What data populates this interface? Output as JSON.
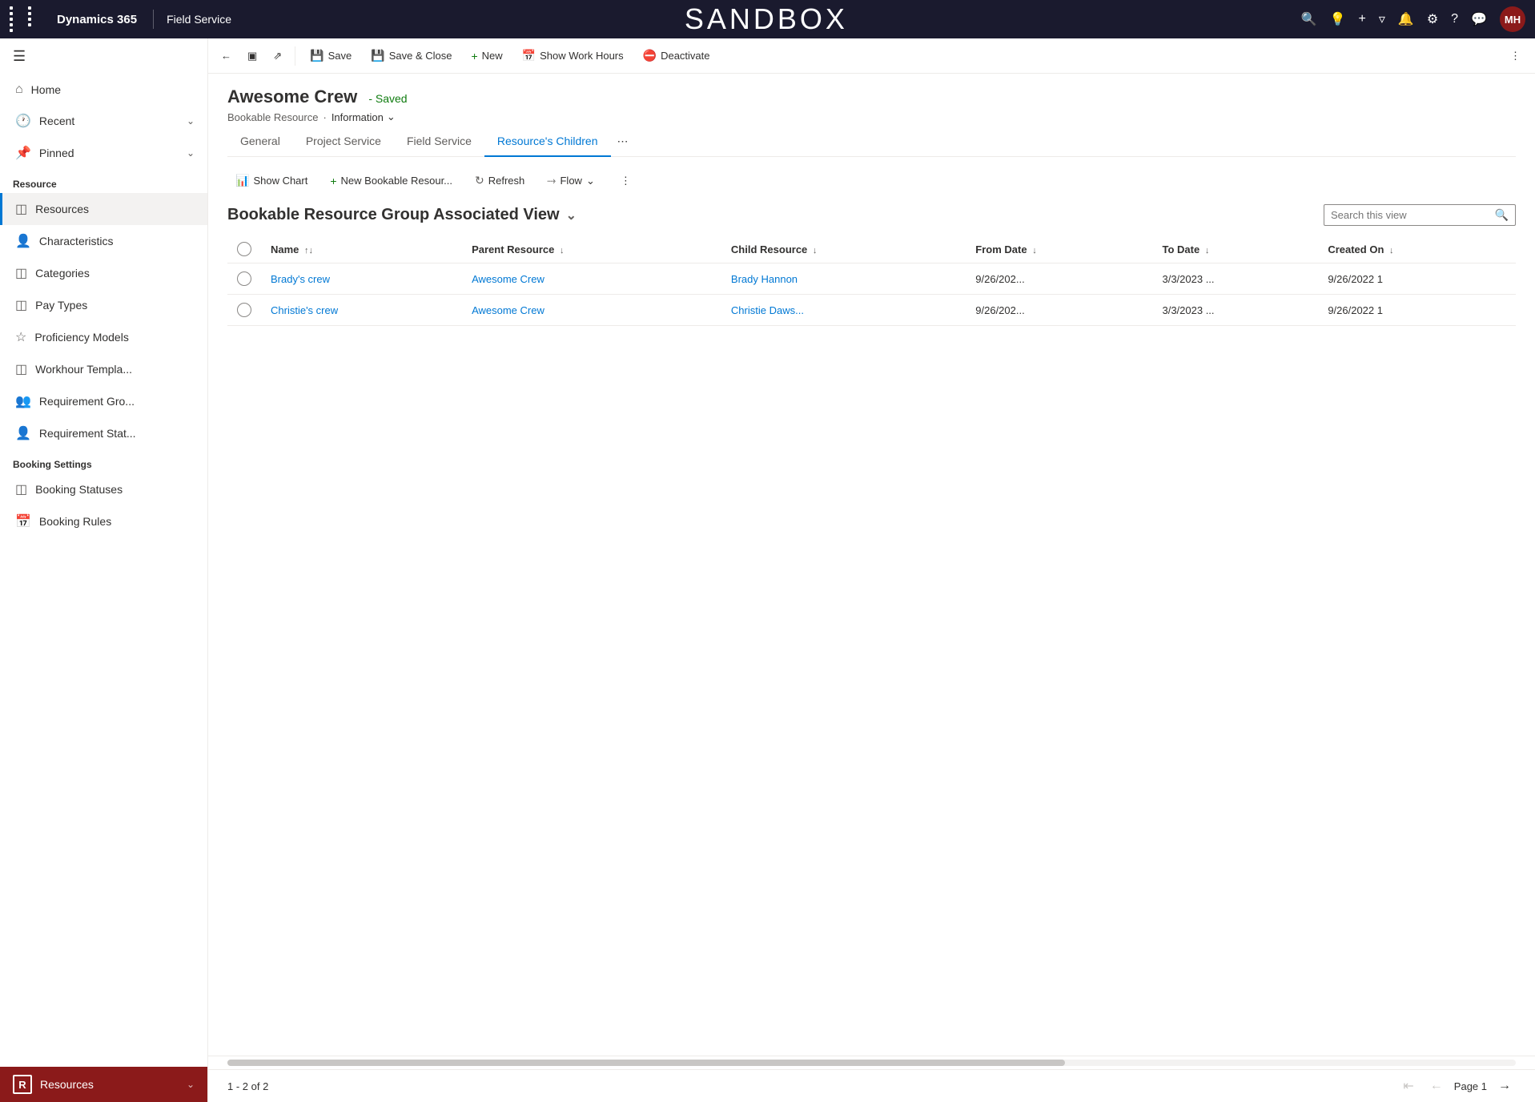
{
  "topNav": {
    "brand": "Dynamics 365",
    "divider": "|",
    "app": "Field Service",
    "sandbox": "SANDBOX",
    "avatarText": "MH"
  },
  "toolbar": {
    "back_label": "←",
    "record_label": "⊞",
    "popup_label": "⤢",
    "save_label": "Save",
    "saveClose_label": "Save & Close",
    "new_label": "New",
    "showWorkHours_label": "Show Work Hours",
    "deactivate_label": "Deactivate",
    "more_label": "⋮"
  },
  "record": {
    "title": "Awesome Crew",
    "savedBadge": "- Saved",
    "breadcrumb1": "Bookable Resource",
    "breadcrumb2": "Information"
  },
  "tabs": [
    {
      "id": "general",
      "label": "General"
    },
    {
      "id": "project-service",
      "label": "Project Service"
    },
    {
      "id": "field-service",
      "label": "Field Service"
    },
    {
      "id": "resources-children",
      "label": "Resource's Children",
      "active": true
    }
  ],
  "subToolbar": {
    "showChart_label": "Show Chart",
    "newBookable_label": "New Bookable Resour...",
    "refresh_label": "Refresh",
    "flow_label": "Flow",
    "more_label": "⋮"
  },
  "viewSelector": {
    "viewName": "Bookable Resource Group Associated View",
    "searchPlaceholder": "Search this view"
  },
  "table": {
    "columns": [
      {
        "id": "name",
        "label": "Name",
        "sortable": true
      },
      {
        "id": "parentResource",
        "label": "Parent Resource",
        "sortable": true
      },
      {
        "id": "childResource",
        "label": "Child Resource",
        "sortable": true
      },
      {
        "id": "fromDate",
        "label": "From Date",
        "sortable": true
      },
      {
        "id": "toDate",
        "label": "To Date",
        "sortable": true
      },
      {
        "id": "createdOn",
        "label": "Created On",
        "sortable": true
      }
    ],
    "rows": [
      {
        "name": "Brady's crew",
        "parentResource": "Awesome Crew",
        "childResource": "Brady Hannon",
        "fromDate": "9/26/202...",
        "toDate": "3/3/2023 ...",
        "createdOn": "9/26/2022 1"
      },
      {
        "name": "Christie's crew",
        "parentResource": "Awesome Crew",
        "childResource": "Christie Daws...",
        "fromDate": "9/26/202...",
        "toDate": "3/3/2023 ...",
        "createdOn": "9/26/2022 1"
      }
    ]
  },
  "footer": {
    "paginationInfo": "1 - 2 of 2",
    "pageLabel": "Page 1"
  },
  "sidebar": {
    "sections": [
      {
        "title": "",
        "items": [
          {
            "id": "home",
            "label": "Home",
            "icon": "🏠"
          },
          {
            "id": "recent",
            "label": "Recent",
            "icon": "🕐",
            "hasChevron": true
          },
          {
            "id": "pinned",
            "label": "Pinned",
            "icon": "📌",
            "hasChevron": true
          }
        ]
      },
      {
        "title": "Resource",
        "items": [
          {
            "id": "resources",
            "label": "Resources",
            "icon": "⊞",
            "active": true
          },
          {
            "id": "characteristics",
            "label": "Characteristics",
            "icon": "👤"
          },
          {
            "id": "categories",
            "label": "Categories",
            "icon": "⊞"
          },
          {
            "id": "pay-types",
            "label": "Pay Types",
            "icon": "⊞"
          },
          {
            "id": "proficiency-models",
            "label": "Proficiency Models",
            "icon": "☆"
          },
          {
            "id": "workhour-templates",
            "label": "Workhour Templa...",
            "icon": "⊞"
          },
          {
            "id": "requirement-groups",
            "label": "Requirement Gro...",
            "icon": "👥"
          },
          {
            "id": "requirement-statuses",
            "label": "Requirement Stat...",
            "icon": "👤"
          }
        ]
      },
      {
        "title": "Booking Settings",
        "items": [
          {
            "id": "booking-statuses",
            "label": "Booking Statuses",
            "icon": "⊞"
          },
          {
            "id": "booking-rules",
            "label": "Booking Rules",
            "icon": "📅"
          }
        ]
      }
    ],
    "bottomItem": {
      "icon": "R",
      "label": "Resources",
      "hasChevron": true
    }
  }
}
